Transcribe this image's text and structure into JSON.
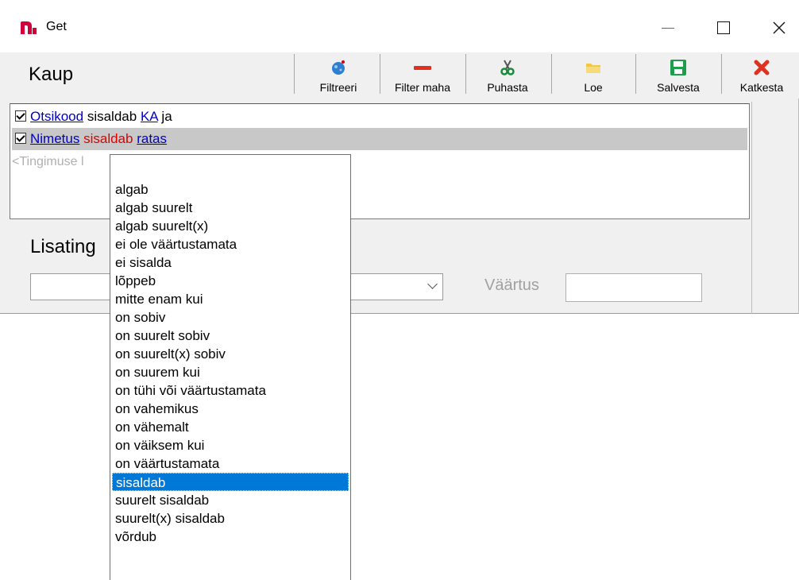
{
  "window": {
    "title": "Get",
    "brand_color": "#d4003c"
  },
  "form": {
    "title": "Kaup"
  },
  "toolbar": {
    "buttons": [
      {
        "label": "Filtreeri",
        "icon": "filter-icon"
      },
      {
        "label": "Filter maha",
        "icon": "remove-filter-icon"
      },
      {
        "label": "Puhasta",
        "icon": "scissors-icon"
      },
      {
        "label": "Loe",
        "icon": "folder-icon"
      },
      {
        "label": "Salvesta",
        "icon": "save-icon"
      },
      {
        "label": "Katkesta",
        "icon": "cancel-icon"
      }
    ]
  },
  "conditions": [
    {
      "field": "Otsikood",
      "op": "sisaldab",
      "value": "KA",
      "join": "ja",
      "checked": true
    },
    {
      "field": "Nimetus",
      "op": "sisaldab",
      "value": "ratas",
      "checked": true
    }
  ],
  "add_condition_placeholder": "<Tingimuse l",
  "extra": {
    "title": "Lisating",
    "value_label": "Väärtus"
  },
  "operator_list": {
    "selected": "sisaldab",
    "items": [
      "algab",
      "algab suurelt",
      "algab suurelt(x)",
      "ei ole väärtustamata",
      "ei sisalda",
      "lõppeb",
      "mitte enam kui",
      "on sobiv",
      "on suurelt sobiv",
      "on suurelt(x) sobiv",
      "on suurem kui",
      "on tühi või väärtustamata",
      "on vahemikus",
      "on vähemalt",
      "on väiksem kui",
      "on väärtustamata",
      "sisaldab",
      "suurelt sisaldab",
      "suurelt(x) sisaldab",
      "võrdub"
    ]
  }
}
